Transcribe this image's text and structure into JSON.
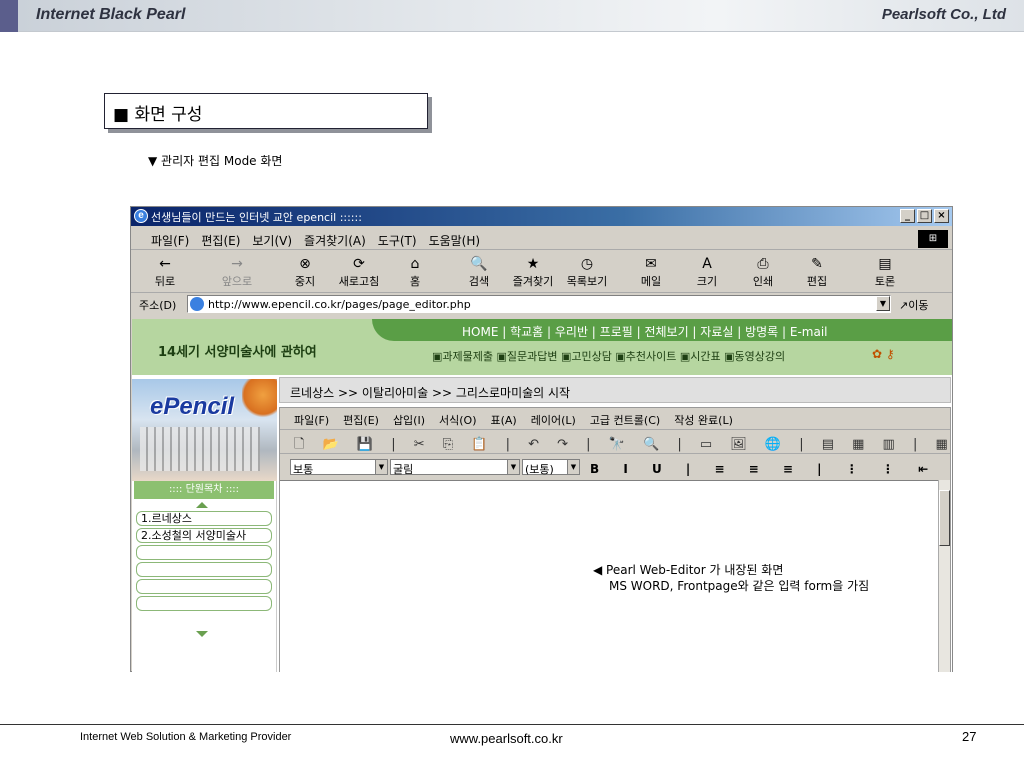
{
  "header": {
    "title": "Internet Black Pearl",
    "company": "Pearlsoft Co., Ltd"
  },
  "section": {
    "title": "■ 화면 구성",
    "subtitle": "▼ 관리자 편집 Mode 화면"
  },
  "browser": {
    "title": "선생님들이 만드는 인터넷 교안 epencil ::::::",
    "window_buttons": [
      "_",
      "□",
      "×"
    ],
    "menu": [
      "파일(F)",
      "편집(E)",
      "보기(V)",
      "즐겨찾기(A)",
      "도구(T)",
      "도움말(H)"
    ],
    "toolbar": [
      {
        "label": "뒤로",
        "icon": "←"
      },
      {
        "label": "앞으로",
        "icon": "→"
      },
      {
        "label": "중지",
        "icon": "⊗"
      },
      {
        "label": "새로고침",
        "icon": "⟳"
      },
      {
        "label": "홈",
        "icon": "⌂"
      },
      {
        "label": "검색",
        "icon": "🔍"
      },
      {
        "label": "즐겨찾기",
        "icon": "★"
      },
      {
        "label": "목록보기",
        "icon": "◷"
      },
      {
        "label": "메일",
        "icon": "✉"
      },
      {
        "label": "크기",
        "icon": "A"
      },
      {
        "label": "인쇄",
        "icon": "⎙"
      },
      {
        "label": "편집",
        "icon": "✎"
      },
      {
        "label": "토론",
        "icon": "▤"
      }
    ],
    "address": {
      "label": "주소(D)",
      "url": "http://www.epencil.co.kr/pages/page_editor.php",
      "go": "이동"
    }
  },
  "site": {
    "title": "14세기 서양미술사에 관하여",
    "nav": "HOME | 학교홈 | 우리반 | 프로필 | 전체보기 | 자료실 | 방명록 | E-mail",
    "subnav": "▣과제물제출 ▣질문과답변 ▣고민상담 ▣추천사이트 ▣시간표 ▣동영상강의",
    "logo": "ePencil",
    "unit_header": ":::: 단원목차 ::::",
    "units": [
      "1.르네상스",
      "2.소성철의 서양미술사",
      "",
      "",
      "",
      ""
    ],
    "breadcrumb": "르네상스 >> 이탈리아미술 >> 그리스로마미술의 시작"
  },
  "editor": {
    "menu": [
      "파일(F)",
      "편집(E)",
      "삽입(I)",
      "서식(O)",
      "표(A)",
      "레이어(L)",
      "고급 컨트롤(C)",
      "작성 완료(L)"
    ],
    "toolbar_icons": "🗋 📂 💾 | ✂ ⎘ 📋 | ↶ ↷ | 🔭 🔍 | ▭ 🖼 🌐 | ▤ ▦ ▥ | ▦ ⇥ ⇤ ⇥ | ⇉ ⇊ ⇉ | ▦ ▦",
    "style": "보통",
    "font": "굴림",
    "size": "(보통)",
    "format_buttons": "B I U | ≡ ≡ ≡ | ⋮ ⋮ ⇤ ⇥ | ✎ 가"
  },
  "note": {
    "line1": "◀ Pearl Web-Editor 가 내장된 화면",
    "line2": "MS WORD, Frontpage와 같은 입력 form을 가짐"
  },
  "footer": {
    "left": "Internet Web Solution & Marketing Provider",
    "center": "www.pearlsoft.co.kr",
    "page": "27"
  }
}
